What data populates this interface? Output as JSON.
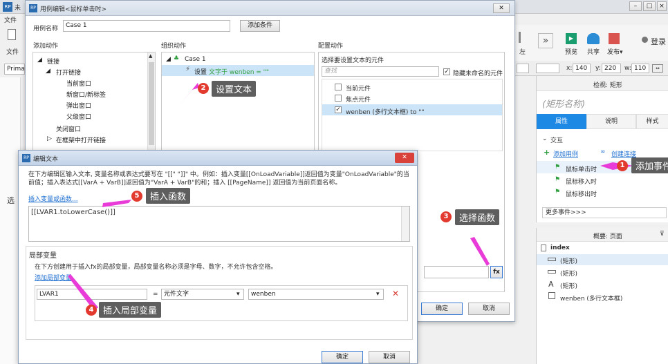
{
  "background_app": {
    "title_fragment": "未",
    "file_menu": "文件",
    "file_tool": "文件",
    "primary_dropdown": "Prima",
    "toolbar": {
      "zoom_label": "左",
      "preview": "预览",
      "share": "共享",
      "publish": "发布▾",
      "login": "登录"
    },
    "coords": {
      "x_label": "x:",
      "x_value": "140",
      "y_label": "y:",
      "y_value": "220",
      "w_label": "w:",
      "w_value": "110"
    },
    "inspector": {
      "header": "检视: 矩形",
      "shape_name": "(矩形名称)",
      "tabs": [
        "属性",
        "说明",
        "样式"
      ],
      "interaction_title": "交互",
      "add_case": "添加用例",
      "create_link": "创建连接",
      "events": [
        "鼠标单击时",
        "鼠标移入时",
        "鼠标移出时"
      ],
      "more_events": "更多事件>>>"
    },
    "outline": {
      "header": "概要: 页面",
      "items": [
        "index",
        "(矩形)",
        "(矩形)",
        "(矩形)",
        "wenben (多行文本框)"
      ]
    },
    "left_panel_fragment": "选"
  },
  "case_editor": {
    "title": "用例编辑<鼠标单击时>",
    "case_name_label": "用例名称",
    "case_name_value": "Case 1",
    "add_condition": "添加条件",
    "col_add_action": "添加动作",
    "col_organize": "组织动作",
    "col_configure": "配置动作",
    "actions_tree": [
      "链接",
      "打开链接",
      "当前窗口",
      "新窗口/新标签",
      "弹出窗口",
      "父级窗口",
      "关闭窗口",
      "在框架中打开链接"
    ],
    "organize": {
      "case": "Case 1",
      "action_prefix": "设置",
      "action_text": "文字于 wenben = \"\""
    },
    "configure_title": "选择要设置文本的元件",
    "search_placeholder": "查找",
    "hide_unnamed": "隐藏未命名的元件",
    "widgets": [
      "当前元件",
      "焦点元件",
      "wenben (多行文本框) to \"\""
    ],
    "fx": "fx",
    "ok": "确定",
    "cancel": "取消"
  },
  "text_editor": {
    "title": "编辑文本",
    "description": "在下方编辑区输入文本, 变量名称或表达式要写在 \"[[\" \"]]\" 中。例如：插入变量[[OnLoadVariable]]返回值为变量\"OnLoadVariable\"的当前值；插入表达式[[VarA + VarB]]返回值为\"VarA + VarB\"的和；插入 [[PageName]] 返回值为当前页面名称。",
    "insert_link": "插入变量或函数...",
    "expression": "[[LVAR1.toLowerCase()]]",
    "local_vars_title": "局部变量",
    "local_vars_desc": "在下方创建用于插入fx的局部变量，局部变量名称必须是字母、数字，不允许包含空格。",
    "add_local_var": "添加局部变量",
    "var_name": "LVAR1",
    "equals": "=",
    "var_type": "元件文字",
    "var_target": "wenben",
    "ok": "确定",
    "cancel": "取消"
  },
  "annotations": [
    {
      "num": "1",
      "label": "添加事件"
    },
    {
      "num": "2",
      "label": "设置文本"
    },
    {
      "num": "3",
      "label": "选择函数"
    },
    {
      "num": "4",
      "label": "插入局部变量"
    },
    {
      "num": "5",
      "label": "插入函数"
    }
  ],
  "colors": {
    "accent": "#1e88e5",
    "callout": "#5e5e5e",
    "marker": "#e33a2f",
    "arrow": "#e83bd8",
    "selection": "#cce4f7"
  }
}
